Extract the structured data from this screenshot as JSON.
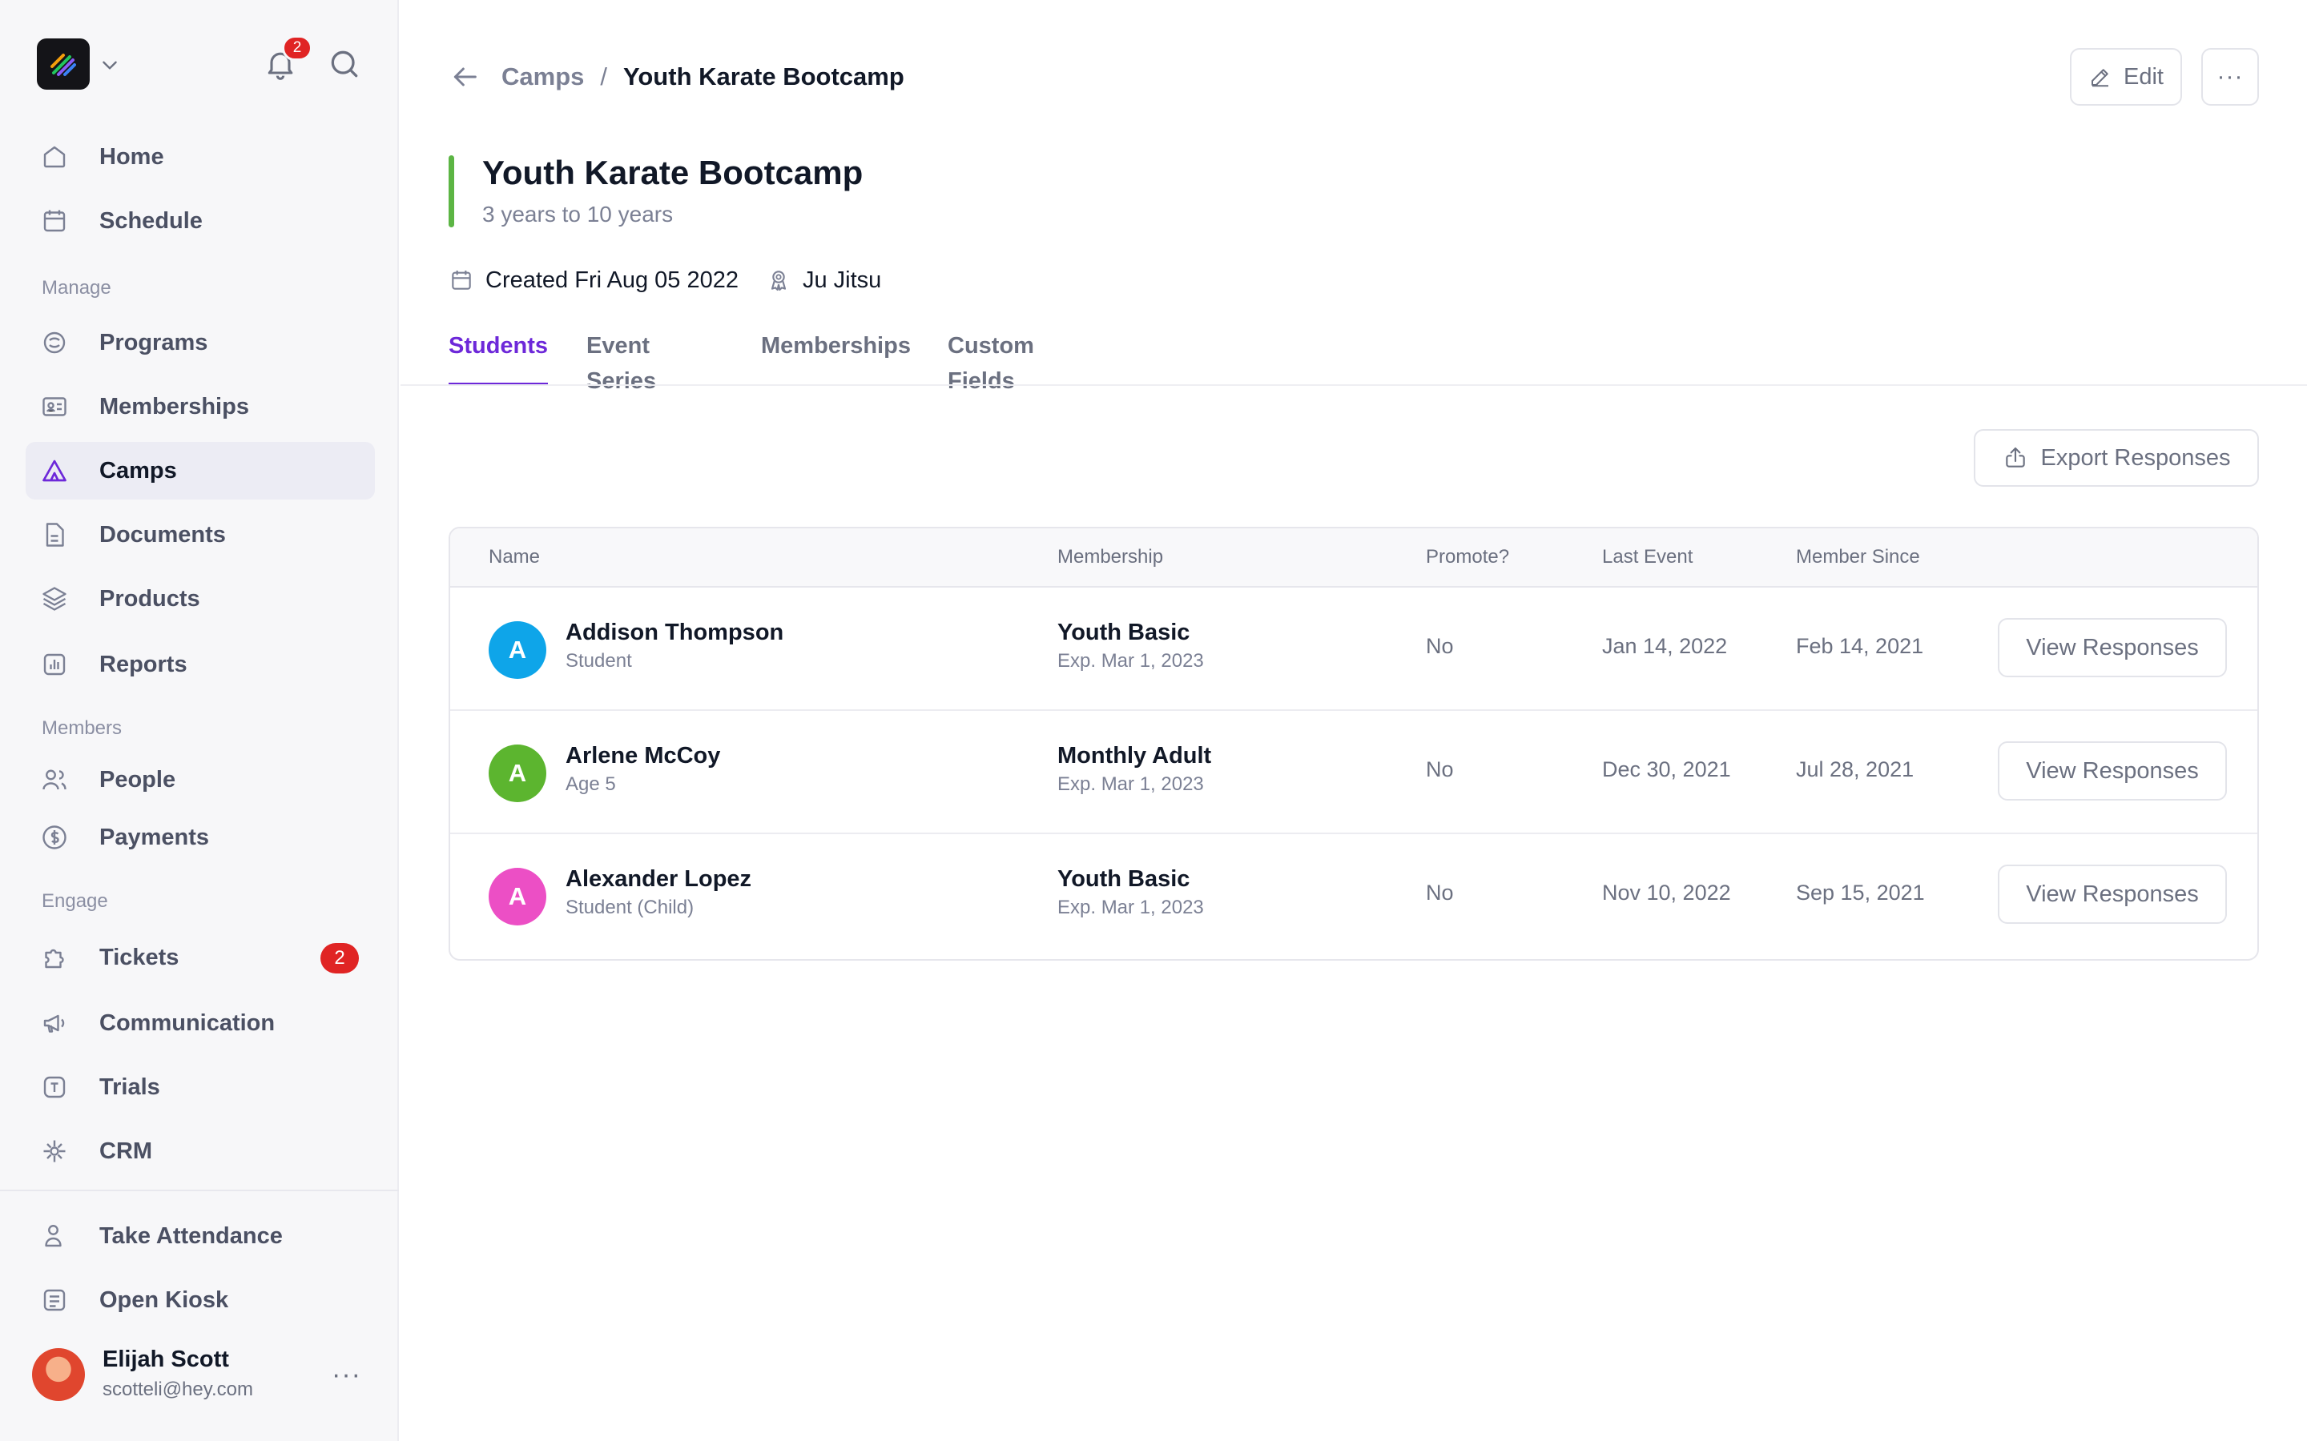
{
  "header": {
    "notification_count": "2"
  },
  "sidebar": {
    "nav": [
      {
        "label": "Home",
        "icon": "home-icon"
      },
      {
        "label": "Schedule",
        "icon": "calendar-icon"
      }
    ],
    "sections": {
      "manage": "Manage",
      "members": "Members",
      "engage": "Engage"
    },
    "manage_items": [
      {
        "label": "Programs",
        "icon": "programs-icon"
      },
      {
        "label": "Memberships",
        "icon": "id-card-icon"
      },
      {
        "label": "Camps",
        "icon": "camp-tent-icon"
      },
      {
        "label": "Documents",
        "icon": "document-icon"
      },
      {
        "label": "Products",
        "icon": "layers-icon"
      },
      {
        "label": "Reports",
        "icon": "report-chart-icon"
      }
    ],
    "member_items": [
      {
        "label": "People",
        "icon": "people-icon"
      },
      {
        "label": "Payments",
        "icon": "dollar-icon"
      }
    ],
    "engage_items": [
      {
        "label": "Tickets",
        "icon": "puzzle-icon",
        "badge": "2"
      },
      {
        "label": "Communication",
        "icon": "megaphone-icon"
      },
      {
        "label": "Trials",
        "icon": "trials-icon"
      },
      {
        "label": "CRM",
        "icon": "crm-icon"
      }
    ],
    "bottom_items": [
      {
        "label": "Take Attendance",
        "icon": "user-check-icon"
      },
      {
        "label": "Open Kiosk",
        "icon": "kiosk-icon"
      }
    ],
    "user": {
      "name": "Elijah Scott",
      "email": "scotteli@hey.com"
    }
  },
  "breadcrumb": {
    "parent": "Camps",
    "separator": "/",
    "current": "Youth Karate Bootcamp"
  },
  "actions": {
    "edit_label": "Edit",
    "more_label": "···"
  },
  "camp": {
    "title": "Youth Karate Bootcamp",
    "age_range": "3 years to 10 years",
    "created": "Created Fri Aug 05 2022",
    "program": "Ju Jitsu",
    "accent_color": "#5cb544"
  },
  "tabs": [
    "Students",
    "Event Series",
    "Memberships",
    "Custom Fields"
  ],
  "export_label": "Export Responses",
  "table": {
    "columns": [
      "Name",
      "Membership",
      "Promote?",
      "Last Event",
      "Member Since"
    ],
    "rows": [
      {
        "initial": "A",
        "avatar_color": "#0ea5e9",
        "name": "Addison Thompson",
        "role": "Student",
        "membership": "Youth Basic",
        "expires": "Exp. Mar 1, 2023",
        "promote": "No",
        "last_event": "Jan 14, 2022",
        "member_since": "Feb 14, 2021",
        "action": "View Responses"
      },
      {
        "initial": "A",
        "avatar_color": "#5cb52f",
        "name": "Arlene McCoy",
        "role": "Age 5",
        "membership": "Monthly Adult",
        "expires": "Exp. Mar 1, 2023",
        "promote": "No",
        "last_event": "Dec 30, 2021",
        "member_since": "Jul 28, 2021",
        "action": "View Responses"
      },
      {
        "initial": "A",
        "avatar_color": "#ec4fc5",
        "name": "Alexander Lopez",
        "role": "Student (Child)",
        "membership": "Youth Basic",
        "expires": "Exp. Mar 1, 2023",
        "promote": "No",
        "last_event": "Nov 10, 2022",
        "member_since": "Sep 15, 2021",
        "action": "View Responses"
      }
    ]
  }
}
